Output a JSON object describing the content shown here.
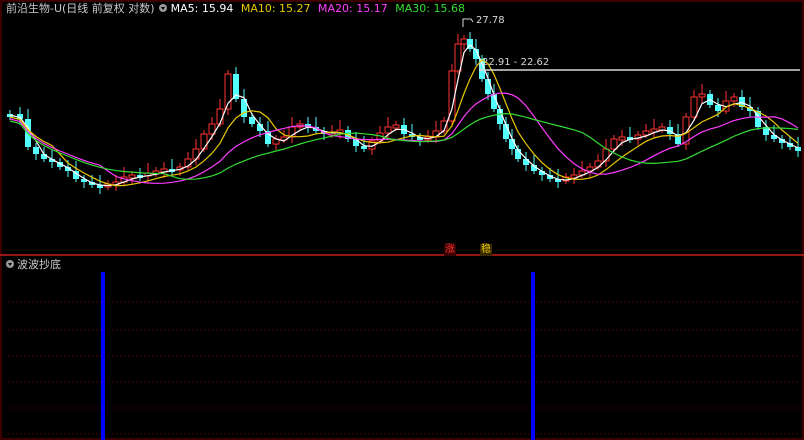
{
  "header": {
    "stock_title": "前沿生物-U(日线 前复权 对数)",
    "ma5_label": "MA5: 15.94",
    "ma10_label": "MA10: 15.27",
    "ma20_label": "MA20: 15.17",
    "ma30_label": "MA30: 15.68"
  },
  "annotations": {
    "high_price": "27.78",
    "range_label": "22.91 - 22.62",
    "tag_zhang": "涨",
    "tag_wen": "稳"
  },
  "indicator": {
    "title": "波波抄底"
  },
  "colors": {
    "ma5": "#ffffff",
    "ma10": "#e8c800",
    "ma20": "#ff3cff",
    "ma30": "#33dd33",
    "up": "#ff3232",
    "down": "#54ffff",
    "signal_bar": "#0000ff",
    "grid": "#7a0000"
  },
  "chart_data": {
    "type": "candlestick",
    "signal_bars_x_index": [
      14,
      76
    ],
    "note_series": [
      "MA5",
      "MA10",
      "MA20",
      "MA30"
    ]
  }
}
